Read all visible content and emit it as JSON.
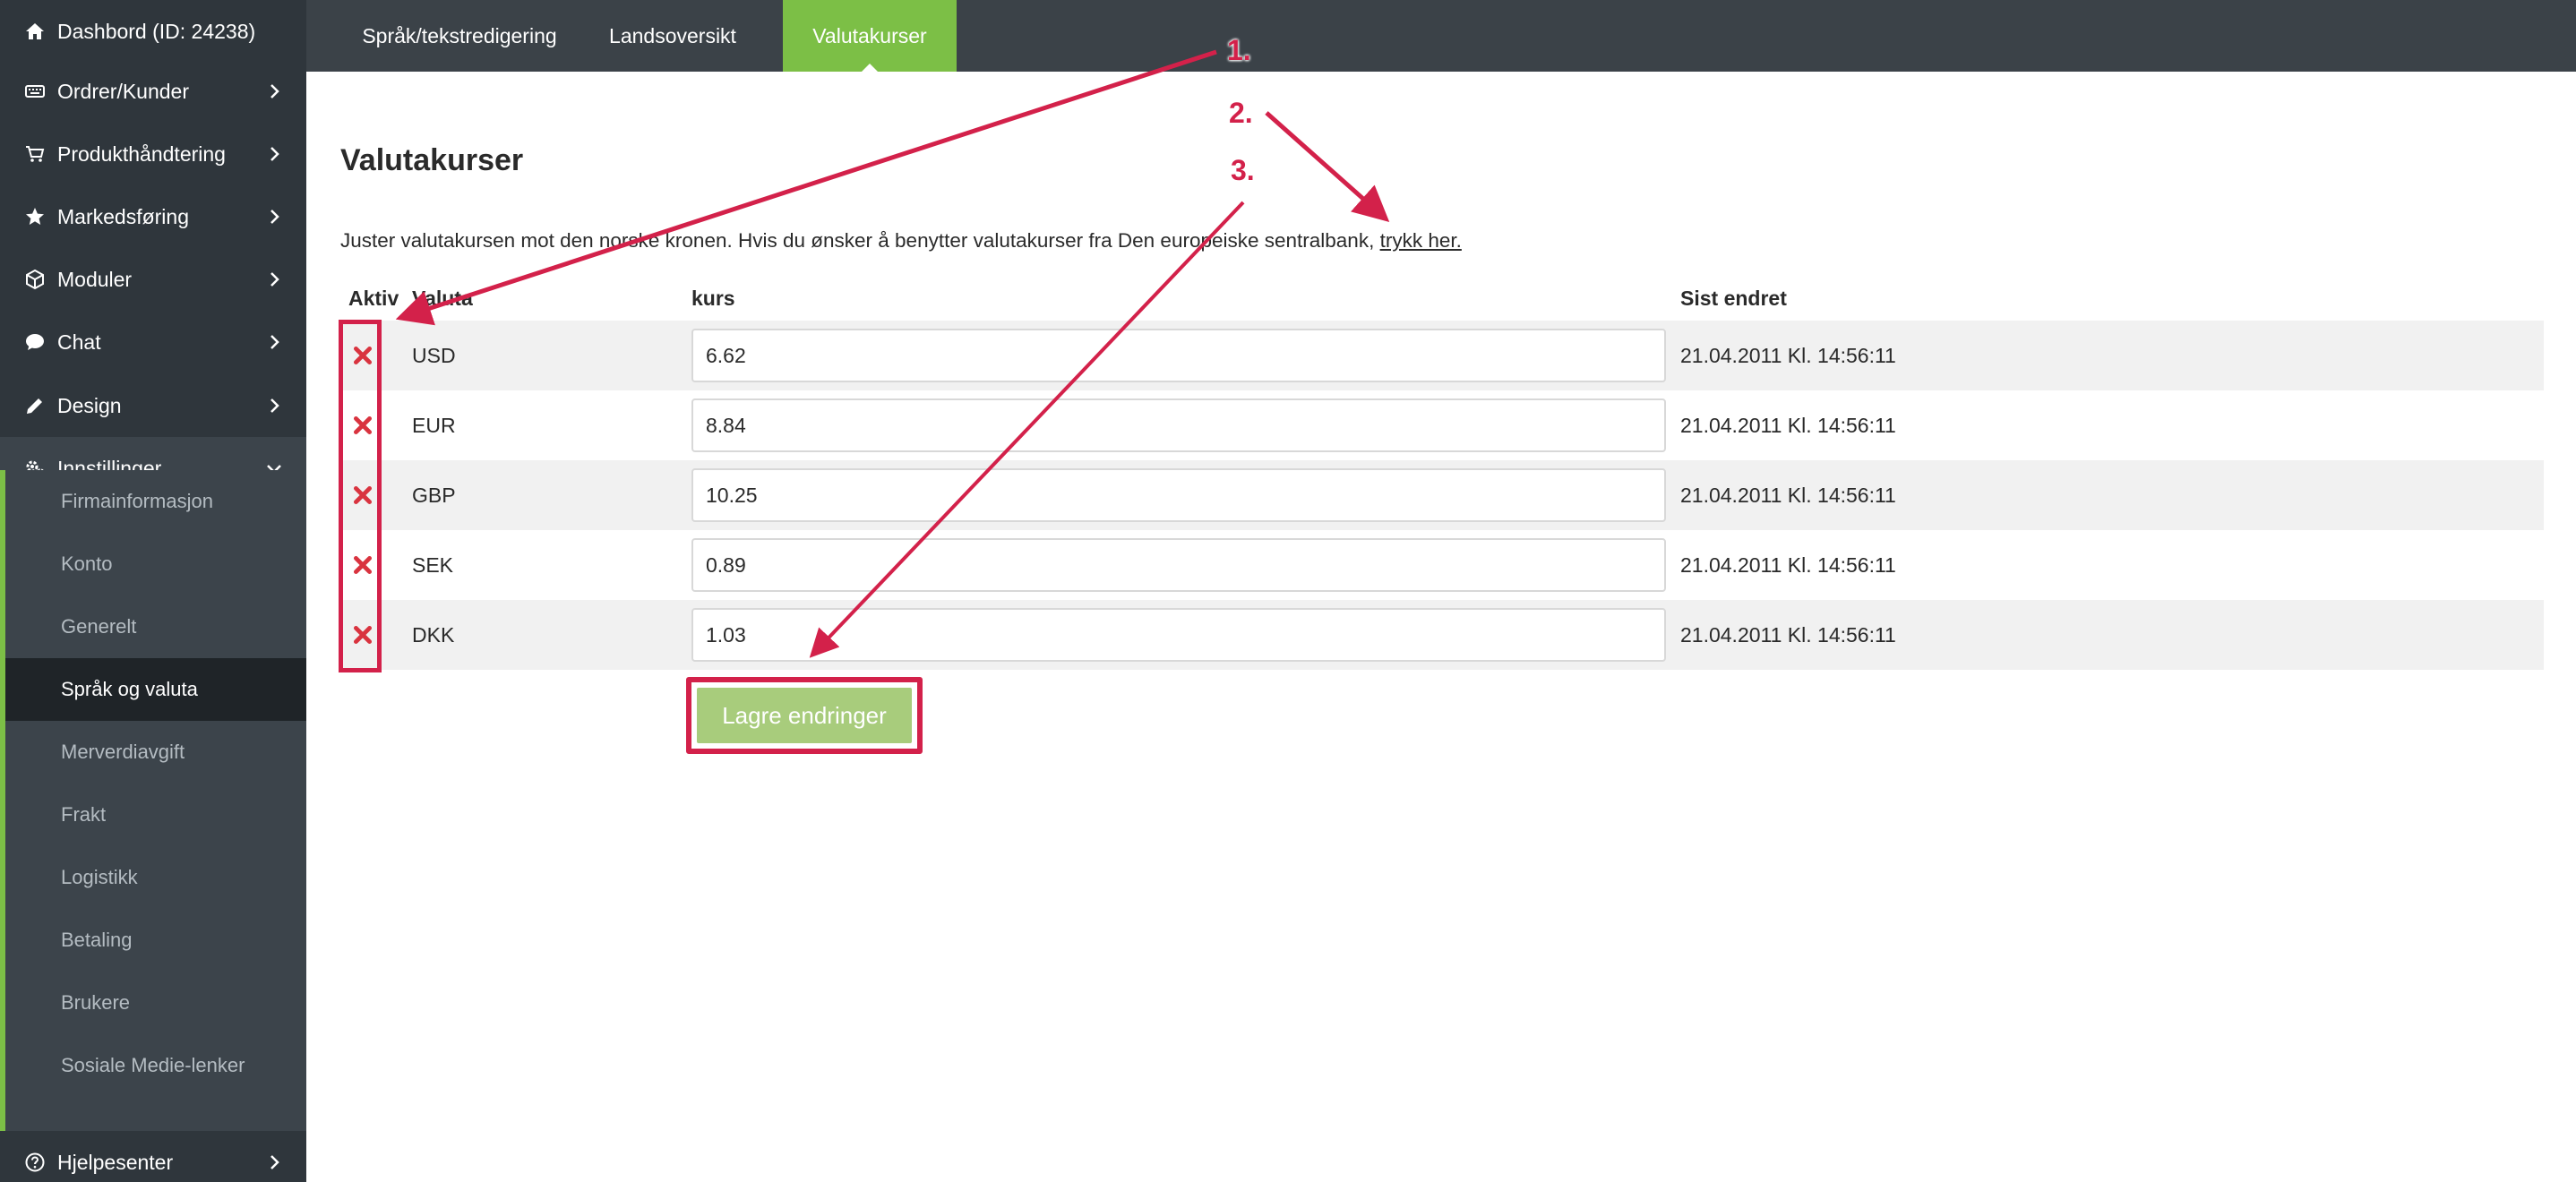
{
  "sidebar": {
    "items": [
      {
        "label": "Dashbord (ID: 24238)",
        "icon": "home-icon"
      },
      {
        "label": "Ordrer/Kunder",
        "icon": "keyboard-icon"
      },
      {
        "label": "Produkthåndtering",
        "icon": "cart-icon"
      },
      {
        "label": "Markedsføring",
        "icon": "star-icon"
      },
      {
        "label": "Moduler",
        "icon": "cube-icon"
      },
      {
        "label": "Chat",
        "icon": "chat-icon"
      },
      {
        "label": "Design",
        "icon": "pencil-icon"
      },
      {
        "label": "Innstillinger",
        "icon": "gears-icon"
      },
      {
        "label": "Hjelpesenter",
        "icon": "question-circle-icon"
      }
    ],
    "submenu": [
      "Firmainformasjon",
      "Konto",
      "Generelt",
      "Språk og valuta",
      "Merverdiavgift",
      "Frakt",
      "Logistikk",
      "Betaling",
      "Brukere",
      "Sosiale Medie-lenker"
    ],
    "active_submenu": "Språk og valuta"
  },
  "tabs": [
    {
      "label": "Språk/tekstredigering",
      "active": false
    },
    {
      "label": "Landsoversikt",
      "active": false
    },
    {
      "label": "Valutakurser",
      "active": true
    }
  ],
  "main": {
    "title": "Valutakurser",
    "intro_text": "Juster valutakursen mot den norske kronen. Hvis du ønsker å benytter valutakurser fra Den europeiske sentralbank, ",
    "intro_link": "trykk her.",
    "table": {
      "headers": {
        "active": "Aktiv",
        "currency": "Valuta",
        "rate": "kurs",
        "changed": "Sist endret"
      },
      "rows": [
        {
          "code": "USD",
          "rate": "6.62",
          "changed": "21.04.2011 Kl. 14:56:11"
        },
        {
          "code": "EUR",
          "rate": "8.84",
          "changed": "21.04.2011 Kl. 14:56:11"
        },
        {
          "code": "GBP",
          "rate": "10.25",
          "changed": "21.04.2011 Kl. 14:56:11"
        },
        {
          "code": "SEK",
          "rate": "0.89",
          "changed": "21.04.2011 Kl. 14:56:11"
        },
        {
          "code": "DKK",
          "rate": "1.03",
          "changed": "21.04.2011 Kl. 14:56:11"
        }
      ]
    },
    "save_label": "Lagre endringer"
  },
  "annotations": [
    "1.",
    "2.",
    "3."
  ],
  "colors": {
    "sidebar_bg": "#2f363c",
    "accent_green": "#7cbf46",
    "button_green": "#a8cc7c",
    "annotation_red": "#d3214a",
    "inactive_x_red": "#d9333f"
  }
}
